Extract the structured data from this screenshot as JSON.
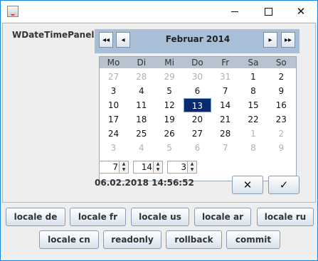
{
  "window": {
    "minimize": "—",
    "maximize": "☐",
    "close": "✕"
  },
  "panel_label": "WDateTimePanel",
  "calendar": {
    "month": "Februar 2014",
    "nav": {
      "prev_year": "◂◂",
      "prev_month": "◂",
      "next_month": "▸",
      "next_year": "▸▸"
    },
    "weekdays": [
      "Mo",
      "Di",
      "Mi",
      "Do",
      "Fr",
      "Sa",
      "So"
    ],
    "weeks": [
      [
        "27",
        "28",
        "29",
        "30",
        "31",
        "1",
        "2"
      ],
      [
        "3",
        "4",
        "5",
        "6",
        "7",
        "8",
        "9"
      ],
      [
        "10",
        "11",
        "12",
        "13",
        "14",
        "15",
        "16"
      ],
      [
        "17",
        "18",
        "19",
        "20",
        "21",
        "22",
        "23"
      ],
      [
        "24",
        "25",
        "26",
        "27",
        "28",
        "1",
        "2"
      ],
      [
        "3",
        "4",
        "5",
        "6",
        "7",
        "8",
        "9"
      ]
    ],
    "other_month": [
      [
        1,
        1,
        1,
        1,
        1,
        0,
        0
      ],
      [
        0,
        0,
        0,
        0,
        0,
        0,
        0
      ],
      [
        0,
        0,
        0,
        0,
        0,
        0,
        0
      ],
      [
        0,
        0,
        0,
        0,
        0,
        0,
        0
      ],
      [
        0,
        0,
        0,
        0,
        0,
        1,
        1
      ],
      [
        1,
        1,
        1,
        1,
        1,
        1,
        1
      ]
    ],
    "selected_day": "13"
  },
  "time": {
    "hour": "7",
    "minute": "14",
    "second": "3"
  },
  "datetime_text": "06.02.2018 14:56:52",
  "actions": {
    "cancel_icon": "✕",
    "ok_icon": "✓"
  },
  "buttons_row1": [
    "locale de",
    "locale fr",
    "locale us",
    "locale ar",
    "locale ru"
  ],
  "buttons_row2": [
    "locale cn",
    "readonly",
    "rollback",
    "commit"
  ],
  "colors": {
    "header": "#a9bfd8",
    "selected": "#0a2a6e",
    "other_month": "#b0b0b0"
  }
}
